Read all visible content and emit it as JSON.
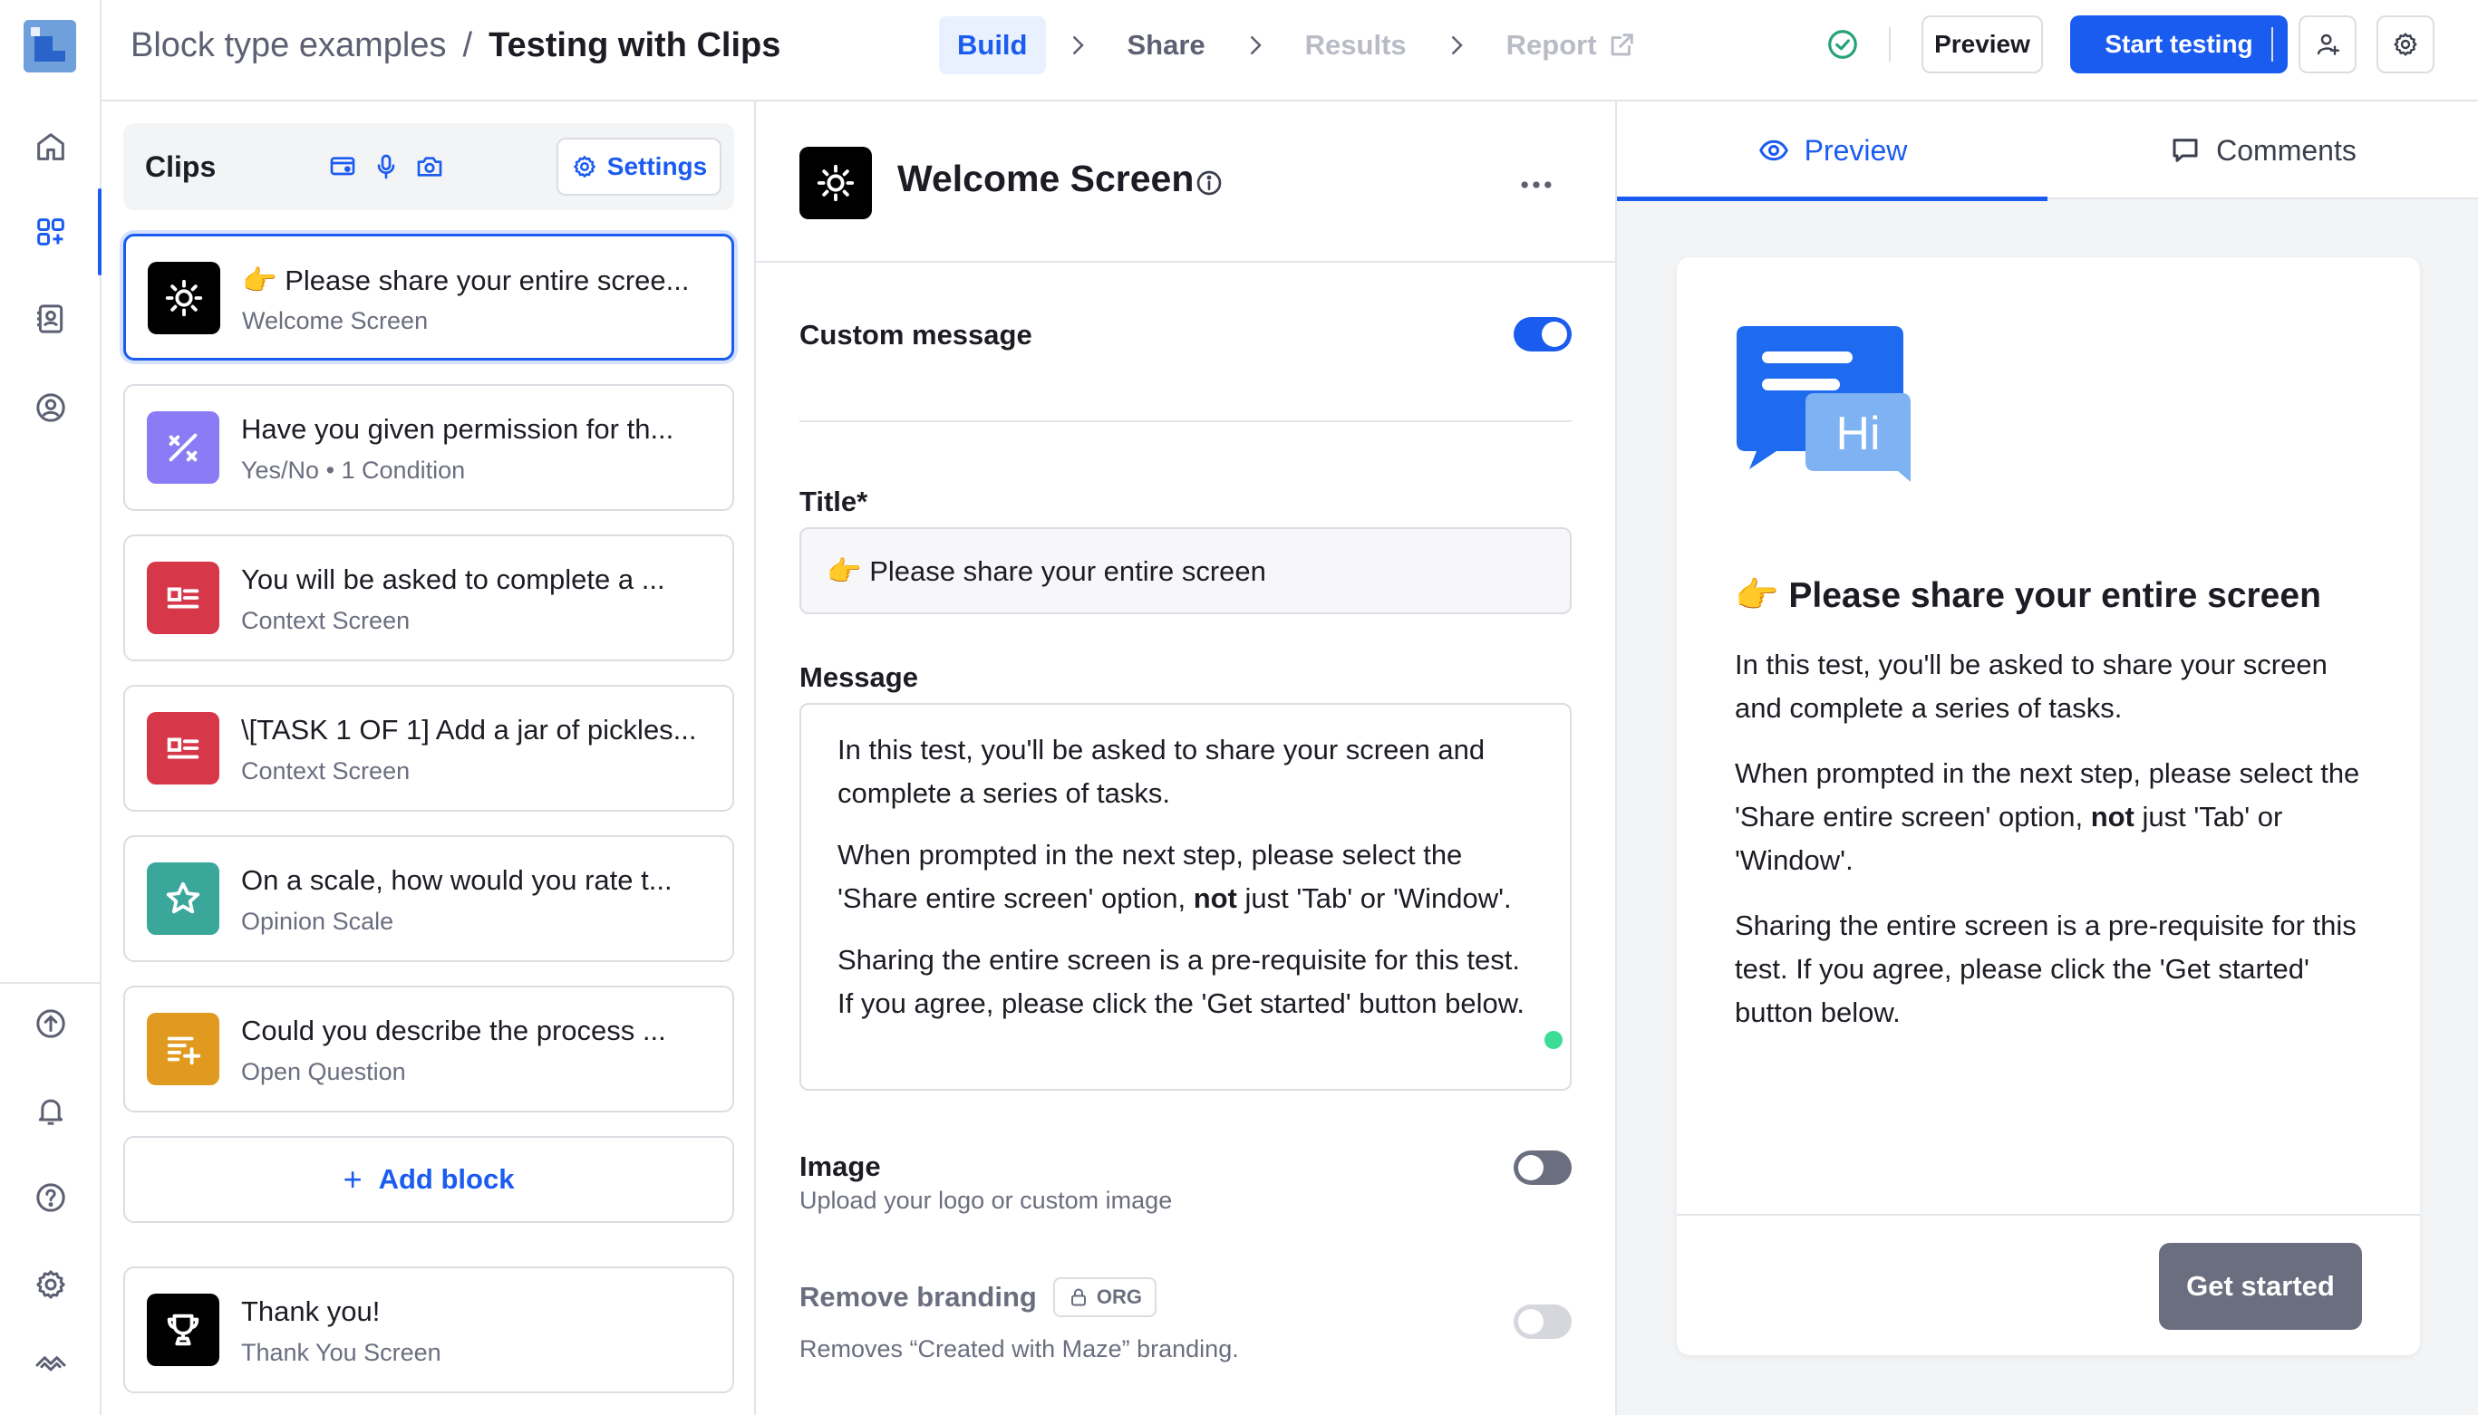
{
  "header": {
    "project_name": "Block type examples",
    "separator": "/",
    "test_name": "Testing with Clips",
    "steps": [
      {
        "label": "Build",
        "state": "active"
      },
      {
        "label": "Share",
        "state": "done"
      },
      {
        "label": "Results",
        "state": "disabled"
      },
      {
        "label": "Report",
        "state": "disabled"
      }
    ],
    "preview_label": "Preview",
    "start_label": "Start testing"
  },
  "rail": {
    "top_icons": [
      "home-icon",
      "blocks-icon",
      "contacts-icon",
      "user-settings-icon"
    ],
    "bottom_icons": [
      "upgrade-icon",
      "bell-icon",
      "help-icon",
      "settings-icon",
      "maze-logo-icon"
    ]
  },
  "clips": {
    "title": "Clips",
    "settings_label": "Settings",
    "blocks": [
      {
        "title": "👉 Please share your entire scree...",
        "subtitle": "Welcome Screen",
        "color": "#000000",
        "icon": "sun-icon"
      },
      {
        "title": "Have you given permission for th...",
        "subtitle": "Yes/No • 1 Condition",
        "color": "#8b7cf6",
        "icon": "percent-icon"
      },
      {
        "title": "You will be asked to complete a ...",
        "subtitle": "Context Screen",
        "color": "#d6384a",
        "icon": "context-icon"
      },
      {
        "title": "\\[TASK 1 OF 1] Add a jar of pickles...",
        "subtitle": "Context Screen",
        "color": "#d6384a",
        "icon": "context-icon"
      },
      {
        "title": "On a scale, how would you rate t...",
        "subtitle": "Opinion Scale",
        "color": "#3aa79a",
        "icon": "star-icon"
      },
      {
        "title": "Could you describe the process ...",
        "subtitle": "Open Question",
        "color": "#e09a1f",
        "icon": "open-question-icon"
      }
    ],
    "add_block_label": "Add block",
    "thank_you": {
      "title": "Thank you!",
      "subtitle": "Thank You Screen",
      "color": "#000000",
      "icon": "trophy-icon"
    }
  },
  "editor": {
    "title": "Welcome Screen",
    "custom_message_label": "Custom message",
    "custom_message_on": true,
    "title_label": "Title*",
    "title_value": "👉 Please share your entire screen",
    "message_label": "Message",
    "message": {
      "p1": "In this test, you'll be asked to share your screen and complete a series of tasks.",
      "p2_pre": "When prompted in the next step, please select the 'Share entire screen' option, ",
      "p2_bold": "not",
      "p2_post": " just 'Tab' or 'Window'.",
      "p3": "Sharing the entire screen is a pre-requisite for this test. If you agree, please click the 'Get started' button below."
    },
    "image_label": "Image",
    "image_help": "Upload your logo or custom image",
    "image_on": false,
    "remove_branding_label": "Remove branding",
    "org_badge": "ORG",
    "remove_branding_help": "Removes “Created with Maze” branding.",
    "remove_branding_on": false
  },
  "preview": {
    "tab_preview": "Preview",
    "tab_comments": "Comments",
    "illustration_text": "Hi",
    "title": "👉 Please share your entire screen",
    "p1": "In this test, you'll be asked to share your screen and complete a series of tasks.",
    "p2_pre": "When prompted in the next step, please select the 'Share entire screen' option, ",
    "p2_bold": "not",
    "p2_post": " just 'Tab' or 'Window'.",
    "p3": "Sharing the entire screen is a pre-requisite for this test. If you agree, please click the 'Get started' button below.",
    "button_label": "Get started"
  },
  "colors": {
    "accent": "#1a5bf0",
    "border": "#dcdde3",
    "muted_text": "#6b6e7f",
    "success": "#26a17b"
  }
}
